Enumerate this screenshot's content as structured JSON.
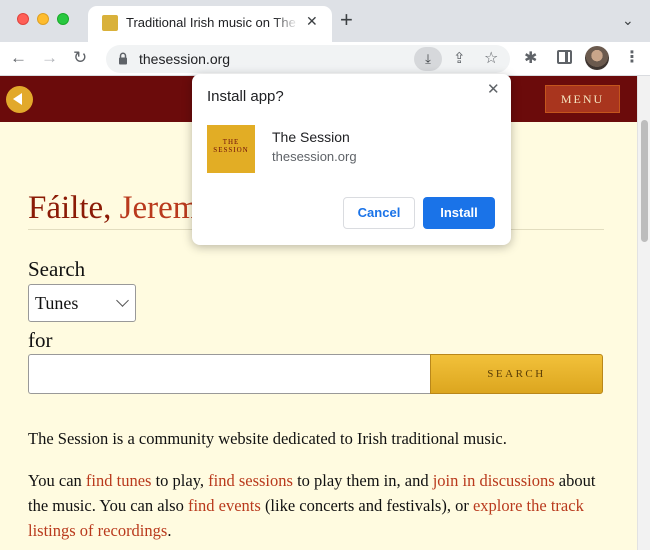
{
  "browser": {
    "tab": {
      "title": "Traditional Irish music on The Session",
      "close_glyph": "✕"
    },
    "new_tab_glyph": "+",
    "tab_menu_glyph": "⌄",
    "nav": {
      "back_glyph": "←",
      "forward_glyph": "→",
      "reload_glyph": "↻"
    },
    "omnibox": {
      "url": "thesession.org"
    },
    "icons": {
      "install": "⤓",
      "share": "⇪",
      "bookmark": "☆",
      "extensions": "✱",
      "menu": "⋮"
    }
  },
  "site": {
    "menu_label": "MENU",
    "welcome_prefix": "Fáilte, ",
    "welcome_name": "Jeremy",
    "search_label": "Search",
    "search_type": {
      "selected": "Tunes"
    },
    "for_label": "for",
    "search_input_value": "",
    "search_button": "SEARCH",
    "para1": "The Session is a community website dedicated to Irish traditional music.",
    "para2": {
      "t1": "You can ",
      "l1": "find tunes",
      "t2": " to play, ",
      "l2": "find sessions",
      "t3": " to play them in, and ",
      "l3": "join in discussions",
      "t4": " about the music. You can also ",
      "l4": "find events",
      "t5": " (like concerts and festivals), or ",
      "l5": "explore the track listings of recordings",
      "t6": "."
    }
  },
  "install_dialog": {
    "title": "Install app?",
    "close_glyph": "✕",
    "app_name": "The Session",
    "app_origin": "thesession.org",
    "icon_text_top": "THE",
    "icon_text_main": "SESSION",
    "cancel_label": "Cancel",
    "install_label": "Install"
  },
  "colors": {
    "header": "#6b0b0b",
    "accent_gold": "#e2a92b",
    "link": "#b93a1d",
    "page_bg": "#fffbe0",
    "primary_button": "#1a73e8"
  }
}
